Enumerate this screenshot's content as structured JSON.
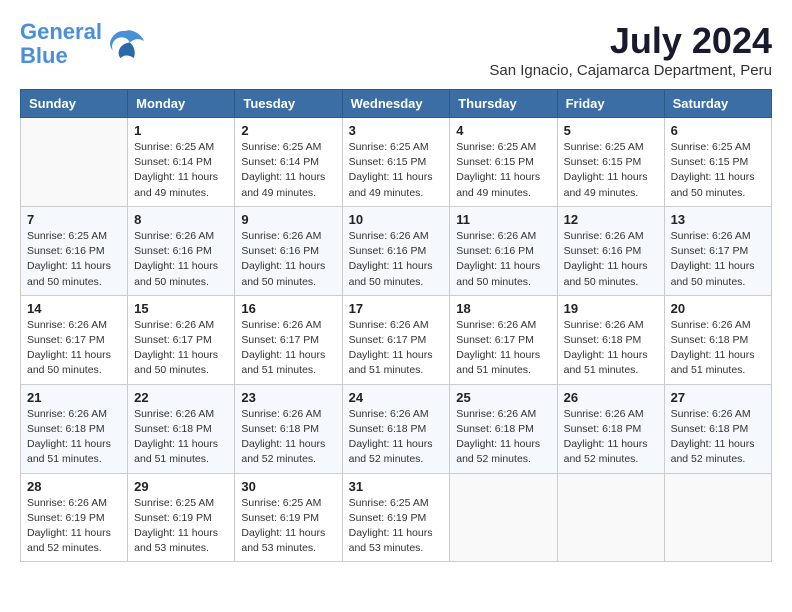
{
  "logo": {
    "line1": "General",
    "line2": "Blue"
  },
  "title": "July 2024",
  "subtitle": "San Ignacio, Cajamarca Department, Peru",
  "headers": [
    "Sunday",
    "Monday",
    "Tuesday",
    "Wednesday",
    "Thursday",
    "Friday",
    "Saturday"
  ],
  "weeks": [
    [
      {
        "day": "",
        "info": ""
      },
      {
        "day": "1",
        "info": "Sunrise: 6:25 AM\nSunset: 6:14 PM\nDaylight: 11 hours\nand 49 minutes."
      },
      {
        "day": "2",
        "info": "Sunrise: 6:25 AM\nSunset: 6:14 PM\nDaylight: 11 hours\nand 49 minutes."
      },
      {
        "day": "3",
        "info": "Sunrise: 6:25 AM\nSunset: 6:15 PM\nDaylight: 11 hours\nand 49 minutes."
      },
      {
        "day": "4",
        "info": "Sunrise: 6:25 AM\nSunset: 6:15 PM\nDaylight: 11 hours\nand 49 minutes."
      },
      {
        "day": "5",
        "info": "Sunrise: 6:25 AM\nSunset: 6:15 PM\nDaylight: 11 hours\nand 49 minutes."
      },
      {
        "day": "6",
        "info": "Sunrise: 6:25 AM\nSunset: 6:15 PM\nDaylight: 11 hours\nand 50 minutes."
      }
    ],
    [
      {
        "day": "7",
        "info": "Sunrise: 6:25 AM\nSunset: 6:16 PM\nDaylight: 11 hours\nand 50 minutes."
      },
      {
        "day": "8",
        "info": "Sunrise: 6:26 AM\nSunset: 6:16 PM\nDaylight: 11 hours\nand 50 minutes."
      },
      {
        "day": "9",
        "info": "Sunrise: 6:26 AM\nSunset: 6:16 PM\nDaylight: 11 hours\nand 50 minutes."
      },
      {
        "day": "10",
        "info": "Sunrise: 6:26 AM\nSunset: 6:16 PM\nDaylight: 11 hours\nand 50 minutes."
      },
      {
        "day": "11",
        "info": "Sunrise: 6:26 AM\nSunset: 6:16 PM\nDaylight: 11 hours\nand 50 minutes."
      },
      {
        "day": "12",
        "info": "Sunrise: 6:26 AM\nSunset: 6:16 PM\nDaylight: 11 hours\nand 50 minutes."
      },
      {
        "day": "13",
        "info": "Sunrise: 6:26 AM\nSunset: 6:17 PM\nDaylight: 11 hours\nand 50 minutes."
      }
    ],
    [
      {
        "day": "14",
        "info": "Sunrise: 6:26 AM\nSunset: 6:17 PM\nDaylight: 11 hours\nand 50 minutes."
      },
      {
        "day": "15",
        "info": "Sunrise: 6:26 AM\nSunset: 6:17 PM\nDaylight: 11 hours\nand 50 minutes."
      },
      {
        "day": "16",
        "info": "Sunrise: 6:26 AM\nSunset: 6:17 PM\nDaylight: 11 hours\nand 51 minutes."
      },
      {
        "day": "17",
        "info": "Sunrise: 6:26 AM\nSunset: 6:17 PM\nDaylight: 11 hours\nand 51 minutes."
      },
      {
        "day": "18",
        "info": "Sunrise: 6:26 AM\nSunset: 6:17 PM\nDaylight: 11 hours\nand 51 minutes."
      },
      {
        "day": "19",
        "info": "Sunrise: 6:26 AM\nSunset: 6:18 PM\nDaylight: 11 hours\nand 51 minutes."
      },
      {
        "day": "20",
        "info": "Sunrise: 6:26 AM\nSunset: 6:18 PM\nDaylight: 11 hours\nand 51 minutes."
      }
    ],
    [
      {
        "day": "21",
        "info": "Sunrise: 6:26 AM\nSunset: 6:18 PM\nDaylight: 11 hours\nand 51 minutes."
      },
      {
        "day": "22",
        "info": "Sunrise: 6:26 AM\nSunset: 6:18 PM\nDaylight: 11 hours\nand 51 minutes."
      },
      {
        "day": "23",
        "info": "Sunrise: 6:26 AM\nSunset: 6:18 PM\nDaylight: 11 hours\nand 52 minutes."
      },
      {
        "day": "24",
        "info": "Sunrise: 6:26 AM\nSunset: 6:18 PM\nDaylight: 11 hours\nand 52 minutes."
      },
      {
        "day": "25",
        "info": "Sunrise: 6:26 AM\nSunset: 6:18 PM\nDaylight: 11 hours\nand 52 minutes."
      },
      {
        "day": "26",
        "info": "Sunrise: 6:26 AM\nSunset: 6:18 PM\nDaylight: 11 hours\nand 52 minutes."
      },
      {
        "day": "27",
        "info": "Sunrise: 6:26 AM\nSunset: 6:18 PM\nDaylight: 11 hours\nand 52 minutes."
      }
    ],
    [
      {
        "day": "28",
        "info": "Sunrise: 6:26 AM\nSunset: 6:19 PM\nDaylight: 11 hours\nand 52 minutes."
      },
      {
        "day": "29",
        "info": "Sunrise: 6:25 AM\nSunset: 6:19 PM\nDaylight: 11 hours\nand 53 minutes."
      },
      {
        "day": "30",
        "info": "Sunrise: 6:25 AM\nSunset: 6:19 PM\nDaylight: 11 hours\nand 53 minutes."
      },
      {
        "day": "31",
        "info": "Sunrise: 6:25 AM\nSunset: 6:19 PM\nDaylight: 11 hours\nand 53 minutes."
      },
      {
        "day": "",
        "info": ""
      },
      {
        "day": "",
        "info": ""
      },
      {
        "day": "",
        "info": ""
      }
    ]
  ]
}
